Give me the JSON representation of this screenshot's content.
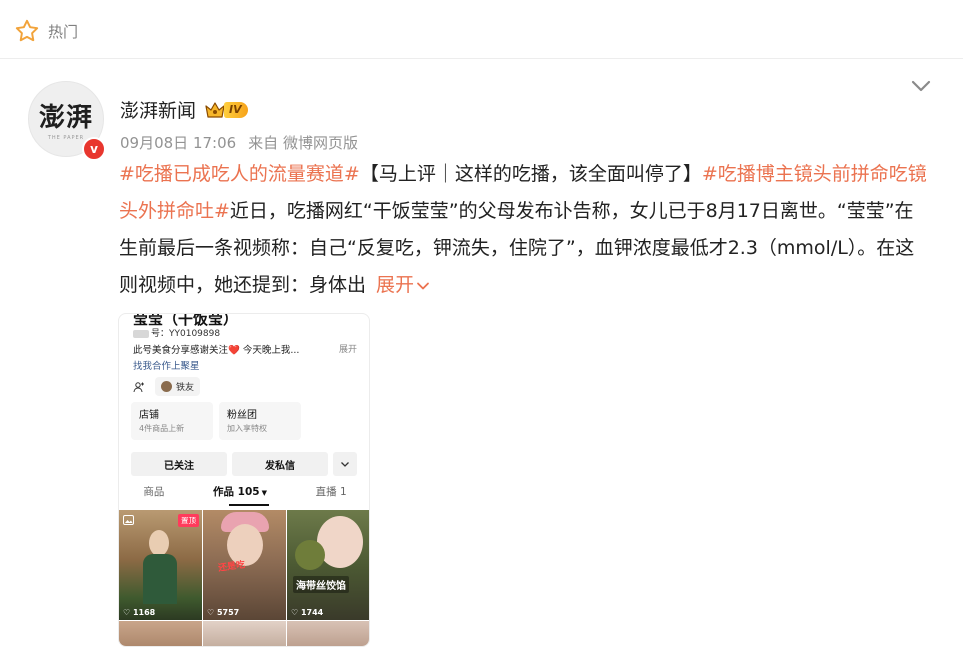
{
  "header": {
    "hot_label": "热门"
  },
  "post": {
    "author": "澎湃新闻",
    "avatar_text": "澎湃",
    "avatar_sub": "THE PAPER",
    "vip_level": "IV",
    "verified_mark": "v",
    "date": "09月08日 17:06",
    "source": "来自 微博网页版",
    "text": {
      "tag1": "#吃播已成吃人的流量赛道#",
      "part1": "【马上评｜这样的吃播，该全面叫停了】",
      "tag2": "#吃播博主镜头前拼命吃镜头外拼命吐#",
      "part2": "近日，吃播网红“干饭莹莹”的父母发布讣告称，女儿已于8月17日离世。“莹莹”在生前最后一条视频称：自己“反复吃，钾流失，住院了”，血钾浓度最低才2.3（mmol/L）。在这则视频中，她还提到：身体出",
      "expand": "展开"
    },
    "image": {
      "profile_name": "莹莹（干饭莹）",
      "id_label": "号：YY0109898",
      "bio_start": "此号美食分享感谢关注",
      "bio_heart": "❤️",
      "bio_end": " 今天晚上我...",
      "bio_more": "展开",
      "link": "找我合作上聚星",
      "friends": "铁友",
      "card1_title": "店铺",
      "card1_desc": "4件商品上新",
      "card2_title": "粉丝团",
      "card2_desc": "加入享特权",
      "followed": "已关注",
      "message": "发私信",
      "tab_goods": "商品",
      "tab_works": "作品 105",
      "tab_live": "直播 1",
      "pinned": "置顶",
      "caption2": "还是吃",
      "caption3": "海带丝饺馅",
      "likes": [
        "1168",
        "5757",
        "1744"
      ]
    }
  },
  "colors": {
    "accent": "#eb7350",
    "verify": "#e8362e",
    "vip": "#f6a21a"
  }
}
